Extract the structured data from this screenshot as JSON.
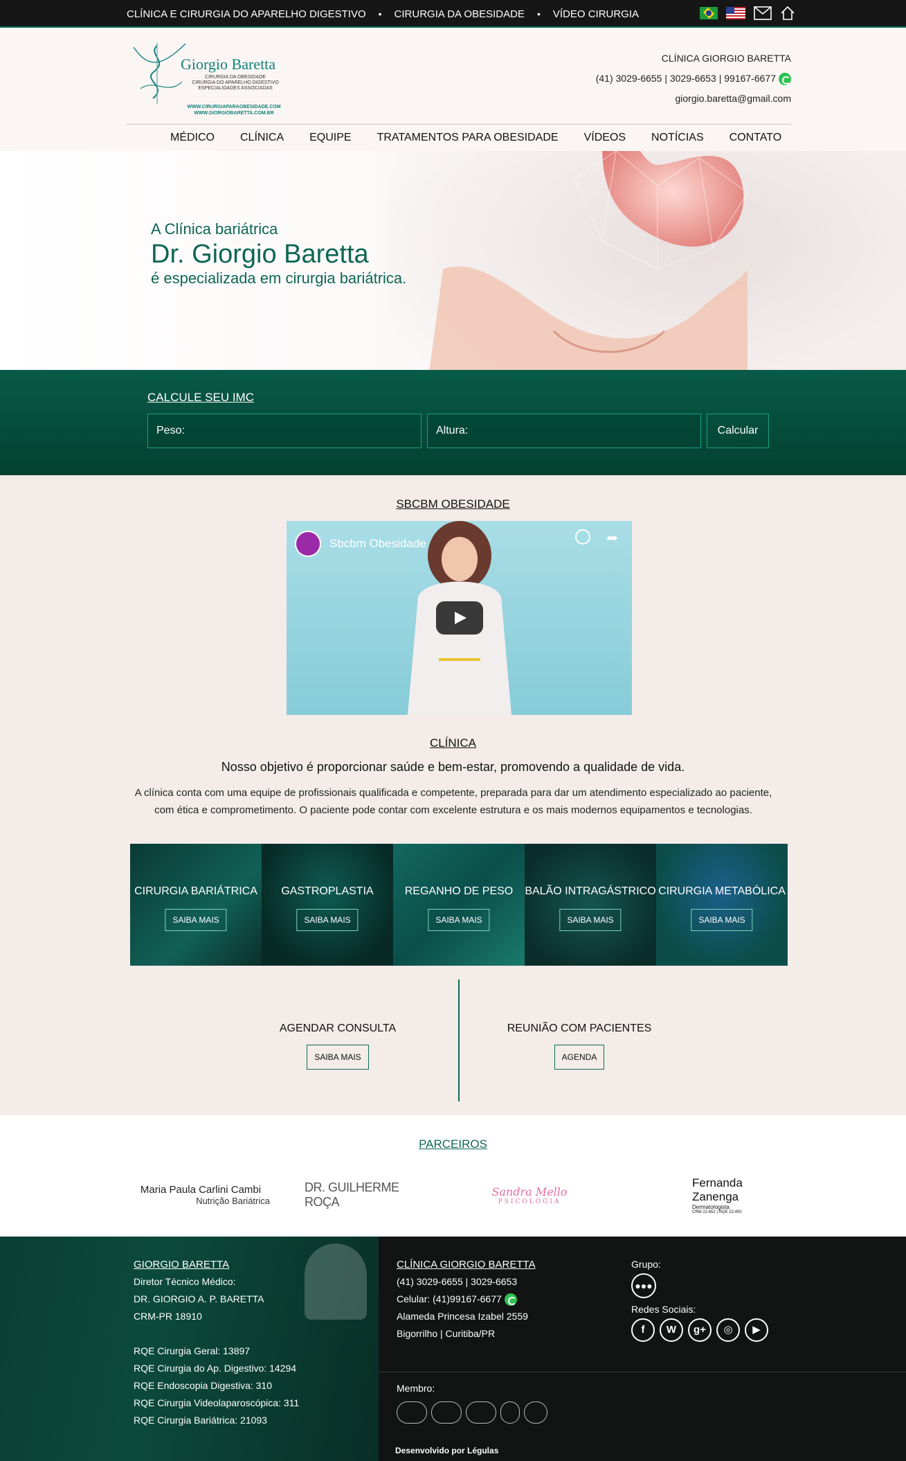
{
  "topbar": {
    "link1": "CLÍNICA E CIRURGIA DO APARELHO DIGESTIVO",
    "link2": "CIRURGIA DA OBESIDADE",
    "link3": "VÍDEO CIRURGIA",
    "separator": "•"
  },
  "logo": {
    "brand": "Giorgio Baretta",
    "sub1": "CIRURGIA DA OBESIDADE",
    "sub2": "CIRURGIA DO APARELHO DIGESTIVO",
    "sub3": "ESPECIALIDADES ASSOCIADAS",
    "url1": "WWW.CIRURGIAPARAOBESIDADE.COM",
    "url2": "WWW.GIORGIOBARETTA.COM.BR"
  },
  "header": {
    "clinic_name": "CLÍNICA GIORGIO BARETTA",
    "phones": "(41) 3029-6655 | 3029-6653 | 99167-6677",
    "email": "giorgio.baretta@gmail.com"
  },
  "nav": [
    "MÉDICO",
    "CLÍNICA",
    "EQUIPE",
    "TRATAMENTOS PARA OBESIDADE",
    "VÍDEOS",
    "NOTÍCIAS",
    "CONTATO"
  ],
  "hero": {
    "line1": "A Clínica bariátrica",
    "line2": "Dr. Giorgio Baretta",
    "line3": "é especializada em cirurgia bariátrica."
  },
  "imc": {
    "title": "CALCULE SEU IMC",
    "weight_label": "Peso:",
    "height_label": "Altura:",
    "button": "Calcular"
  },
  "video_section": {
    "title": "SBCBM OBESIDADE",
    "video_title": "Sbcbm Obesidade"
  },
  "clinic": {
    "title": "CLÍNICA",
    "subtitle": "Nosso objetivo é proporcionar saúde e bem-estar, promovendo a qualidade de vida.",
    "text": "A clínica conta com uma equipe de profissionais qualificada e competente, preparada para dar um atendimento especializado ao paciente, com ética e comprometimento. O paciente pode contar com excelente estrutura e os mais modernos equipamentos e tecnologias."
  },
  "tiles": [
    {
      "name": "CIRURGIA BARIÁTRICA",
      "button": "SAIBA MAIS"
    },
    {
      "name": "GASTROPLASTIA",
      "button": "SAIBA MAIS"
    },
    {
      "name": "REGANHO DE PESO",
      "button": "SAIBA MAIS"
    },
    {
      "name": "BALÃO INTRAGÁSTRICO",
      "button": "SAIBA MAIS"
    },
    {
      "name": "CIRURGIA METABÓLICA",
      "button": "SAIBA MAIS"
    }
  ],
  "cta": {
    "left_title": "AGENDAR CONSULTA",
    "left_button": "SAIBA MAIS",
    "right_title": "REUNIÃO COM PACIENTES",
    "right_button": "AGENDA"
  },
  "partners": {
    "title": "PARCEIROS",
    "p1_a": "Maria Paula Carlini Cambi",
    "p1_b": "Nutrição Bariátrica",
    "p2": "DR. GUILHERME ROÇA",
    "p3_a": "Sandra Mello",
    "p3_b": "PSICOLOGIA",
    "p4_a": "Fernanda",
    "p4_b": "Zanenga",
    "p4_c": "Dermatologista",
    "p4_d": "CRM 22.652 | RQE 22.450"
  },
  "footer": {
    "col1_title": "GIORGIO BARETTA",
    "col1_l1": "Diretor Técnico Médico:",
    "col1_l2": "DR. GIORGIO A. P. BARETTA",
    "col1_l3": "CRM-PR 18910",
    "col1_r1": "RQE Cirurgia Geral: 13897",
    "col1_r2": "RQE Cirurgia do Ap. Digestivo: 14294",
    "col1_r3": "RQE Endoscopia Digestiva: 310",
    "col1_r4": "RQE Cirurgia Videolaparoscópica: 311",
    "col1_r5": "RQE Cirurgia Bariátrica: 21093",
    "col2_title": "CLÍNICA GIORGIO BARETTA",
    "col2_l1": "(41) 3029-6655 | 3029-6653",
    "col2_l2": "Celular: (41)99167-6677",
    "col2_l3": "Alameda Princesa Izabel 2559",
    "col2_l4": "Bigorrilho | Curitiba/PR",
    "group_label": "Grupo:",
    "social_label": "Redes Sociais:",
    "social": [
      "f",
      "W",
      "g+",
      "◎",
      "▶"
    ],
    "member_label": "Membro:",
    "developed": "Desenvolvido por Légulas"
  },
  "colors": {
    "accent": "#0c6b55",
    "dark": "#121313",
    "whatsapp": "#2ec251"
  }
}
